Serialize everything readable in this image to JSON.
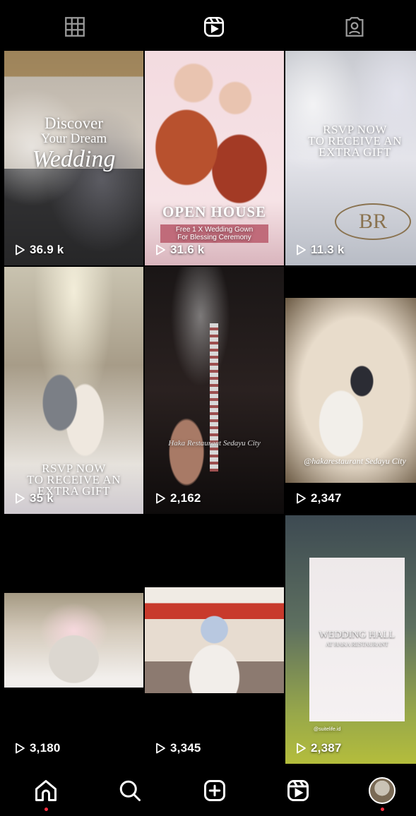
{
  "tabs": [
    {
      "name": "grid",
      "icon": "grid-icon"
    },
    {
      "name": "reels",
      "icon": "reels-icon"
    },
    {
      "name": "tagged",
      "icon": "tagged-icon"
    }
  ],
  "posts": [
    {
      "views": "36.9 k",
      "overlay_lines": [
        "Discover",
        "Your Dream",
        "Wedding"
      ]
    },
    {
      "views": "31.6 k",
      "overlay_lines": [
        "OPEN HOUSE",
        "Free 1 X Wedding Gown",
        "For Blessing Ceremony"
      ]
    },
    {
      "views": "11.3 k",
      "overlay_lines": [
        "RSVP NOW",
        "TO RECEIVE AN",
        "EXTRA GIFT"
      ]
    },
    {
      "views": "35 k",
      "overlay_lines": [
        "RSVP NOW",
        "TO RECEIVE AN",
        "EXTRA GIFT"
      ]
    },
    {
      "views": "2,162",
      "overlay_lines": [
        "Haka Restaurant Sedayu City"
      ]
    },
    {
      "views": "2,347",
      "overlay_lines": [
        "@hakarestaurant Sedayu City"
      ]
    },
    {
      "views": "3,180",
      "overlay_lines": []
    },
    {
      "views": "3,345",
      "overlay_lines": []
    },
    {
      "views": "2,387",
      "overlay_lines": [
        "WEDDING HALL",
        "AT HAKA RESTAURANT",
        "@suitelife.id"
      ]
    }
  ],
  "bottom_nav": [
    {
      "name": "home",
      "icon": "home-icon",
      "notification_dot": true
    },
    {
      "name": "search",
      "icon": "search-icon",
      "notification_dot": false
    },
    {
      "name": "create",
      "icon": "plus-square-icon",
      "notification_dot": false
    },
    {
      "name": "reels",
      "icon": "reels-icon",
      "notification_dot": false
    },
    {
      "name": "profile",
      "icon": "avatar",
      "notification_dot": true
    }
  ],
  "colors": {
    "background": "#000000",
    "notification": "#ff3040"
  }
}
